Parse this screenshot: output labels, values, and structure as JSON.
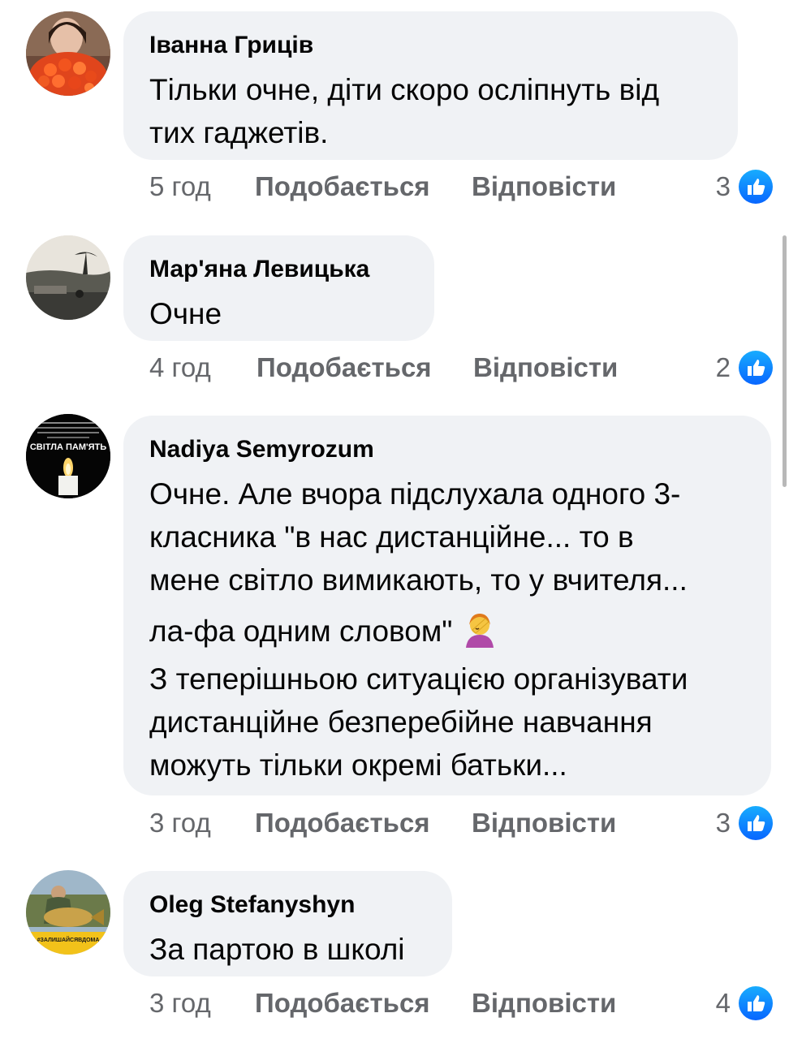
{
  "comments": [
    {
      "author": "Іванна Гриців",
      "lines": [
        "Тільки очне, діти скоро осліпнуть від",
        "тих гаджетів."
      ],
      "time": "5 год",
      "like": "Подобається",
      "reply": "Відповісти",
      "reactions": "3",
      "avatar_icon": "roses-photo"
    },
    {
      "author": "Мар'яна Левицька",
      "lines": [
        "Очне"
      ],
      "time": "4 год",
      "like": "Подобається",
      "reply": "Відповісти",
      "reactions": "2",
      "avatar_icon": "sunset-landscape-photo"
    },
    {
      "author": "Nadiya Semyrozum",
      "lines": [
        "Очне. Але вчора підслухала одного 3-",
        "класника \"в нас дистанційне... то в",
        "мене світло вимикають, то у вчителя...",
        "ла-фа одним словом\"",
        "З теперішньою ситуацією організувати",
        "дистанційне безперебійне навчання",
        "можуть тільки окремі батьки..."
      ],
      "avatar_text": "СВІТЛА ПАМ'ЯТЬ",
      "time": "3 год",
      "like": "Подобається",
      "reply": "Відповісти",
      "reactions": "3",
      "avatar_icon": "memorial-candle",
      "emoji_icon": "facepalm-emoji"
    },
    {
      "author": "Oleg Stefanyshyn",
      "lines": [
        "За партою в школі"
      ],
      "avatar_text": "#ЗАЛИШАЙСЯВДОМА",
      "time": "3 год",
      "like": "Подобається",
      "reply": "Відповісти",
      "reactions": "4",
      "avatar_icon": "fisherman-carp-photo"
    }
  ],
  "colors": {
    "bubble": "#f0f2f5",
    "meta": "#65676b",
    "like_blue": "#0866ff"
  }
}
